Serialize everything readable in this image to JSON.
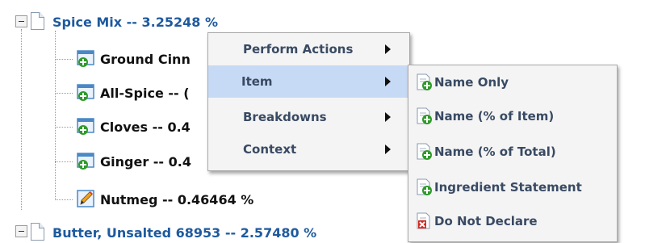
{
  "tree": {
    "parents": [
      {
        "label": "Spice Mix -- 3.25248 %"
      },
      {
        "label": "Butter, Unsalted 68953 -- 2.57480 %"
      }
    ],
    "children": [
      {
        "label": "Ground Cinn",
        "icon": "add-ingredient-icon"
      },
      {
        "label": "All-Spice -- (",
        "icon": "add-ingredient-icon"
      },
      {
        "label": "Cloves -- 0.4",
        "icon": "add-ingredient-icon"
      },
      {
        "label": "Ginger -- 0.4",
        "icon": "add-ingredient-icon"
      },
      {
        "label": "Nutmeg -- 0.46464 %",
        "icon": "edit-ingredient-icon"
      }
    ]
  },
  "context_menu": {
    "items": [
      {
        "label": "Perform Actions",
        "has_submenu": true
      },
      {
        "label": "Item",
        "has_submenu": true,
        "active": true
      },
      {
        "label": "Breakdowns",
        "has_submenu": true
      },
      {
        "label": "Context",
        "has_submenu": true
      }
    ]
  },
  "submenu": {
    "items": [
      {
        "label": "Name Only",
        "icon": "page-add-icon"
      },
      {
        "label": "Name (% of Item)",
        "icon": "page-add-icon"
      },
      {
        "label": "Name (% of Total)",
        "icon": "page-add-icon"
      },
      {
        "label": "Ingredient Statement",
        "icon": "page-add-icon"
      },
      {
        "label": "Do Not Declare",
        "icon": "page-delete-icon"
      }
    ]
  },
  "colors": {
    "parent_text": "#1e5a9e",
    "menu_text": "#394a63",
    "menu_bg": "#f4f4f4",
    "menu_highlight": "#c7daf5",
    "add_badge": "#2e9a2a",
    "delete_badge": "#d42a1e"
  }
}
